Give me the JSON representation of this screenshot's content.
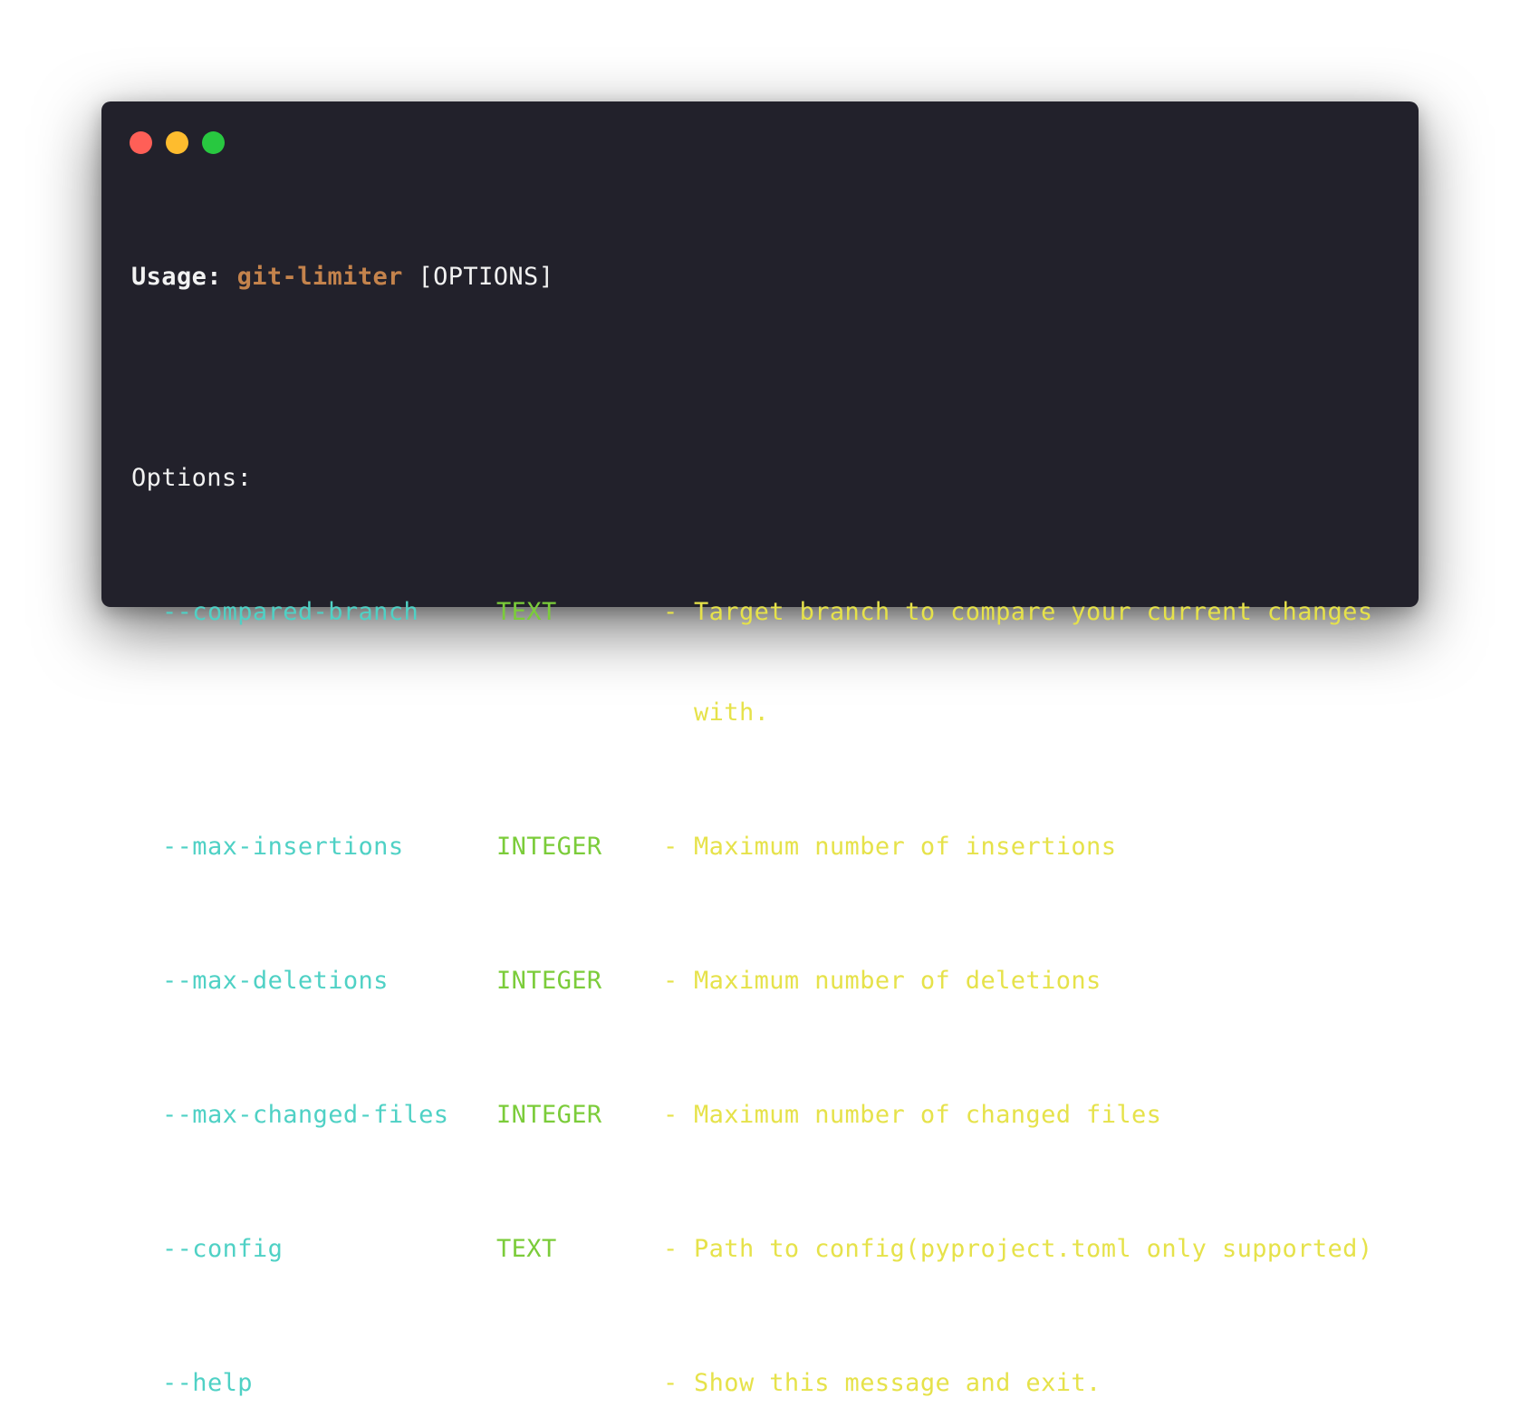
{
  "colors": {
    "window_bg": "#22212b",
    "text": "#f2f2f2",
    "program": "#c4834c",
    "flag": "#4fd1c5",
    "type": "#7bcc3a",
    "description": "#e6e24a",
    "close": "#ff5f57",
    "minimize": "#febc2e",
    "maximize": "#28c840"
  },
  "window_controls": {
    "icons": [
      "close-icon",
      "minimize-icon",
      "maximize-icon"
    ]
  },
  "usage": {
    "label": "Usage:",
    "program": "git-limiter",
    "args": "[OPTIONS]"
  },
  "options_header": "Options:",
  "options": [
    {
      "flag": "--compared-branch",
      "type": "TEXT",
      "dash": "-",
      "desc": [
        "Target branch to compare your current changes",
        "with."
      ]
    },
    {
      "flag": "--max-insertions",
      "type": "INTEGER",
      "dash": "-",
      "desc": [
        "Maximum number of insertions"
      ]
    },
    {
      "flag": "--max-deletions",
      "type": "INTEGER",
      "dash": "-",
      "desc": [
        "Maximum number of deletions"
      ]
    },
    {
      "flag": "--max-changed-files",
      "type": "INTEGER",
      "dash": "-",
      "desc": [
        "Maximum number of changed files"
      ]
    },
    {
      "flag": "--config",
      "type": "TEXT",
      "dash": "-",
      "desc": [
        "Path to config(pyproject.toml only supported)"
      ]
    },
    {
      "flag": "--help",
      "type": "",
      "dash": "-",
      "desc": [
        "Show this message and exit."
      ]
    }
  ]
}
